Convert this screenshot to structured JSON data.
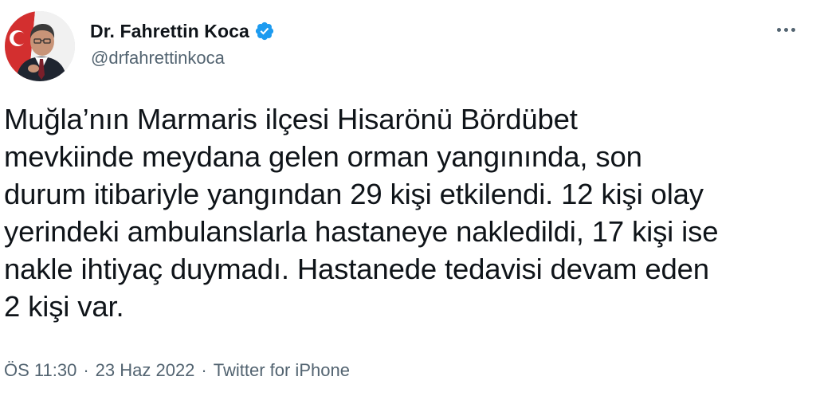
{
  "author": {
    "display_name": "Dr. Fahrettin Koca",
    "handle": "@drfahrettinkoca",
    "verified": true,
    "avatar_icon": "profile-photo",
    "verified_icon": "verified-badge-icon"
  },
  "menu": {
    "icon": "more-horizontal-icon"
  },
  "tweet": {
    "lines": [
      "Muğla’nın Marmaris ilçesi Hisarönü Bördübet",
      "mevkiinde meydana gelen orman yangınında, son",
      "durum itibariyle yangından 29 kişi etkilendi. 12 kişi olay",
      "yerindeki ambulanslarla hastaneye nakledildi, 17 kişi ise",
      "nakle ihtiyaç duymadı. Hastanede tedavisi devam eden",
      "2 kişi var."
    ]
  },
  "meta": {
    "time": "ÖS 11:30",
    "separator": "·",
    "date": "23 Haz 2022",
    "source": "Twitter for iPhone"
  },
  "colors": {
    "text": "#0f1419",
    "secondary": "#536471",
    "verified": "#1d9bf0",
    "background": "#ffffff"
  }
}
